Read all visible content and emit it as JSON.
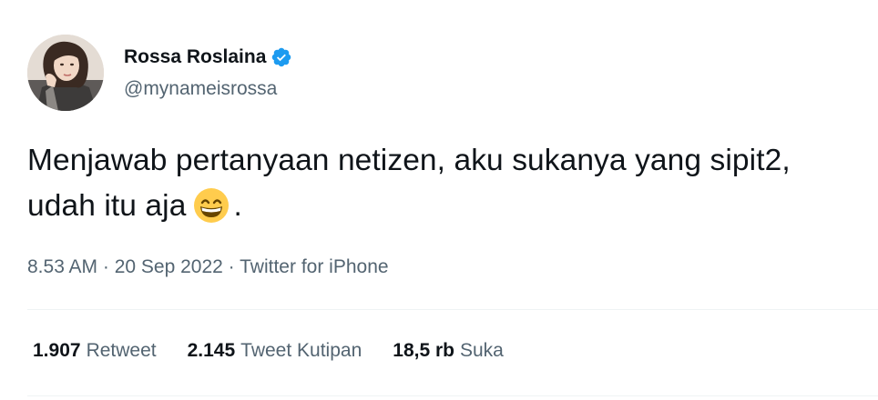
{
  "author": {
    "display_name": "Rossa Roslaina",
    "handle": "@mynameisrossa",
    "verified_icon": "verified-badge-icon",
    "avatar_icon": "profile-photo"
  },
  "tweet": {
    "text_part1": "Menjawab pertanyaan netizen, aku sukanya yang sipit2, udah itu aja",
    "emoji_icon": "grinning-face-with-smiling-eyes",
    "text_part2": "."
  },
  "meta": {
    "time": "8.53 AM",
    "separator": " · ",
    "date": "20 Sep 2022",
    "source": "Twitter for iPhone"
  },
  "stats": {
    "retweets": {
      "count": "1.907",
      "label": "Retweet"
    },
    "quotes": {
      "count": "2.145",
      "label": "Tweet Kutipan"
    },
    "likes": {
      "count": "18,5 rb",
      "label": "Suka"
    }
  },
  "colors": {
    "primary_text": "#0f1419",
    "secondary_text": "#536471",
    "verified_blue": "#1d9bf0",
    "divider": "#eff3f4"
  }
}
